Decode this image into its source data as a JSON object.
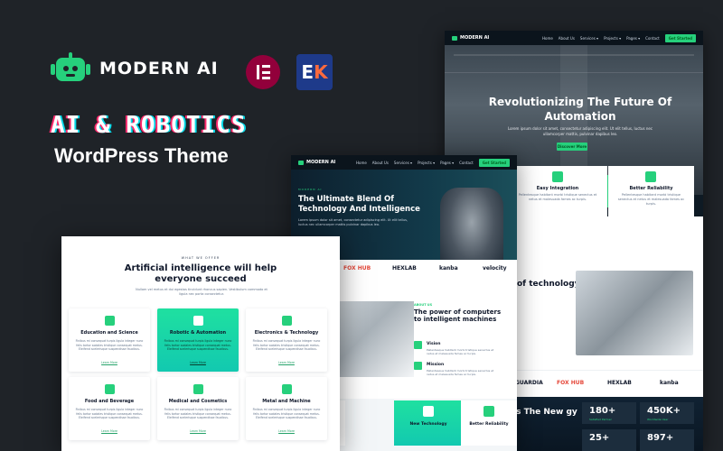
{
  "brand": {
    "name": "MODERN AI",
    "headline": "AI & ROBOTICS",
    "subheadline": "WordPress Theme",
    "builder_logos": [
      "elementor-logo",
      "elementskit-logo"
    ]
  },
  "colors": {
    "background": "#1f2328",
    "accent": "#26d07c",
    "elementor": "#92003b",
    "elementskit": "#1e3a8a"
  },
  "back_preview": {
    "nav": {
      "brand": "MODERN AI",
      "items": [
        "Home",
        "About Us",
        "Services ▾",
        "Projects ▾",
        "Pages ▾",
        "Contact"
      ],
      "cta": "Get Started"
    },
    "hero": {
      "title": "Revolutionizing The Future Of Automation",
      "desc": "Lorem ipsum dolor sit amet, consectetur adipiscing elit. Ut elit tellus, luctus nec ullamcorper mattis, pulvinar dapibus leo.",
      "button": "Discover More"
    },
    "features": [
      {
        "title": "Easy Integration",
        "desc": "Pellentesque habitant morbi tristique senectus et netus et malesuada fames ac turpis."
      },
      {
        "title": "Better Reliability",
        "desc": "Pellentesque habitant morbi tristique senectus et netus et malesuada fames ac turpis."
      }
    ],
    "tech_title": "of technology",
    "logos": [
      "GUARDIA",
      "FOX HUB",
      "HEXLAB",
      "kanba"
    ],
    "new_title": "is The New gy",
    "stats": [
      {
        "value": "180+",
        "label": "Satisfied Partner"
      },
      {
        "value": "450K+",
        "label": "Worldwide User"
      },
      {
        "value": "25+",
        "label": ""
      },
      {
        "value": "897+",
        "label": ""
      }
    ]
  },
  "mid_preview": {
    "nav": {
      "brand": "MODERN AI",
      "items": [
        "Home",
        "About Us",
        "Services ▾",
        "Projects ▾",
        "Pages ▾",
        "Contact"
      ],
      "cta": "Get Started"
    },
    "hero": {
      "tag": "MODERN AI",
      "title": "The Ultimate Blend Of Technology And Intelligence",
      "desc": "Lorem ipsum dolor sit amet, consectetur adipiscing elit. Ut elit tellus, luctus nec ullamcorper mattis pulvinar dapibus leo."
    },
    "logos": [
      "FOX HUB",
      "HEXLAB",
      "kanba",
      "velocity"
    ],
    "about": {
      "tag": "ABOUT US",
      "title": "The power of computers to intelligent machines",
      "items": [
        {
          "title": "Vision",
          "desc": "Pellentesque habitant morbi tristique senectus et netus et malesuada fames ac turpis."
        },
        {
          "title": "Mission",
          "desc": "Pellentesque habitant morbi tristique senectus et netus et malesuada fames ac turpis."
        }
      ]
    },
    "cards": [
      "ration",
      "New Technology",
      "Better Reliability"
    ]
  },
  "front_preview": {
    "tag": "WHAT WE OFFER",
    "title": "Artificial intelligence will help everyone succeed",
    "desc": "Nullam vel metus et dui egestas tincidunt rhoncus sapien. Vestibulum commodo et ligula nec porta consectetur.",
    "services": [
      {
        "title": "Education and Science",
        "desc": "Finibus mi consequat turpis ligula integer nunc felis tortor sodales tristique consequat metus. Eleifend scelerisque suspendisse faucibus.",
        "link": "Learn More"
      },
      {
        "title": "Robotic & Automation",
        "desc": "Finibus mi consequat turpis ligula integer nunc felis tortor sodales tristique consequat metus. Eleifend scelerisque suspendisse faucibus.",
        "link": "Learn More"
      },
      {
        "title": "Electronics & Technology",
        "desc": "Finibus mi consequat turpis ligula integer nunc felis tortor sodales tristique consequat metus. Eleifend scelerisque suspendisse faucibus.",
        "link": "Learn More"
      },
      {
        "title": "Food and Beverage",
        "desc": "Finibus mi consequat turpis ligula integer nunc felis tortor sodales tristique consequat metus. Eleifend scelerisque suspendisse faucibus.",
        "link": "Learn More"
      },
      {
        "title": "Medical and Cosmetics",
        "desc": "Finibus mi consequat turpis ligula integer nunc felis tortor sodales tristique consequat metus. Eleifend scelerisque suspendisse faucibus.",
        "link": "Learn More"
      },
      {
        "title": "Metal and Machine",
        "desc": "Finibus mi consequat turpis ligula integer nunc felis tortor sodales tristique consequat metus. Eleifend scelerisque suspendisse faucibus.",
        "link": "Learn More"
      }
    ]
  }
}
